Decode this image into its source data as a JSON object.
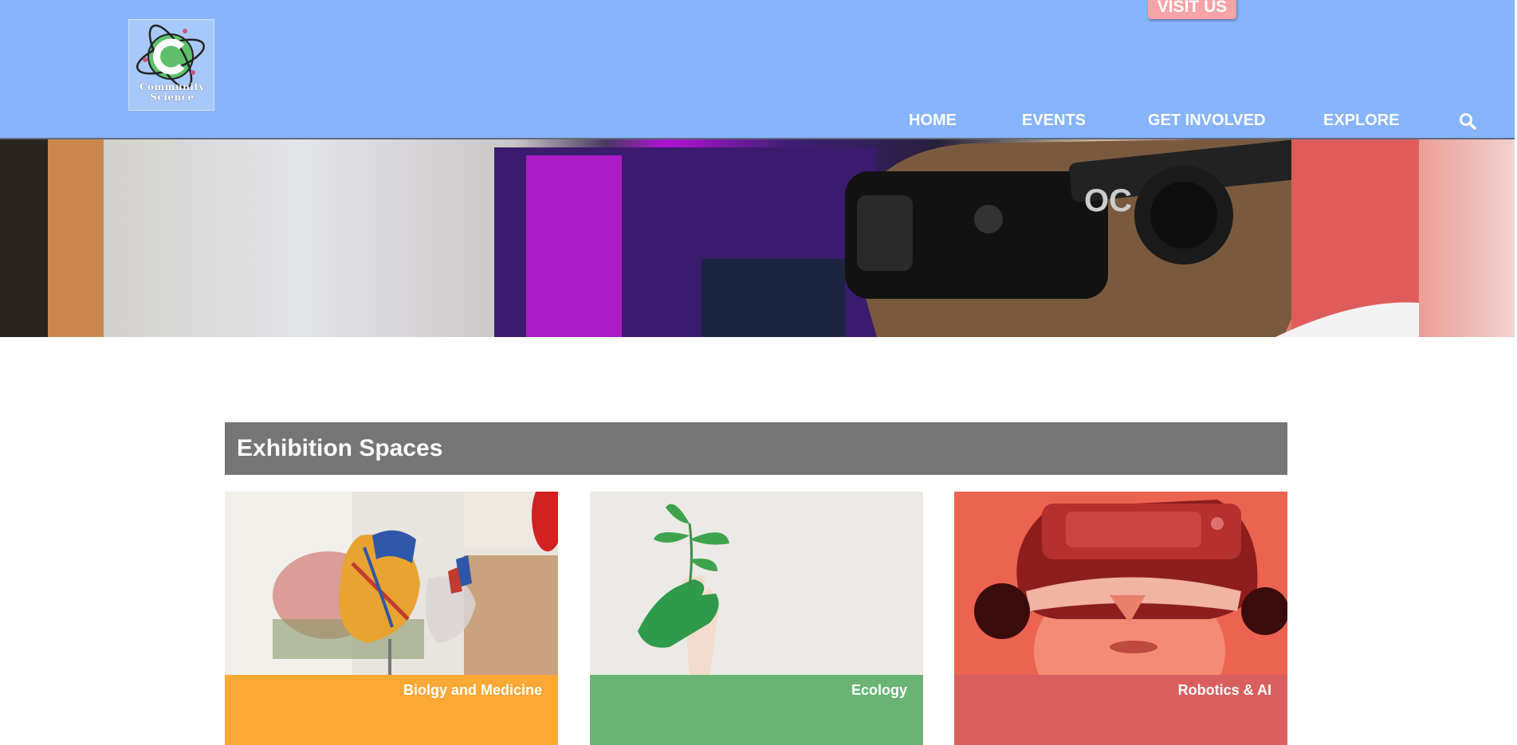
{
  "header": {
    "visit_button": "VISIT US",
    "logo": {
      "line1": "Community",
      "line2": "Science"
    },
    "nav": [
      "HOME",
      "EVENTS",
      "GET INVOLVED",
      "EXPLORE"
    ],
    "search_icon": "search-icon",
    "colors": {
      "header_bg": "#88b4fb",
      "visit_bg": "#f8a3a6"
    }
  },
  "hero": {
    "image": "person-wearing-vr-headset-photo"
  },
  "exhibitions": {
    "title": "Exhibition Spaces",
    "cards": [
      {
        "label": "Biolgy and Medicine",
        "image": "anatomical-heart-model-photo",
        "color": "#fca834"
      },
      {
        "label": "Ecology",
        "image": "green-hand-holding-plant-photo",
        "color": "#6ab476"
      },
      {
        "label": "Robotics & AI",
        "image": "vr-headset-red-photo",
        "color": "#d95f5e"
      }
    ]
  }
}
